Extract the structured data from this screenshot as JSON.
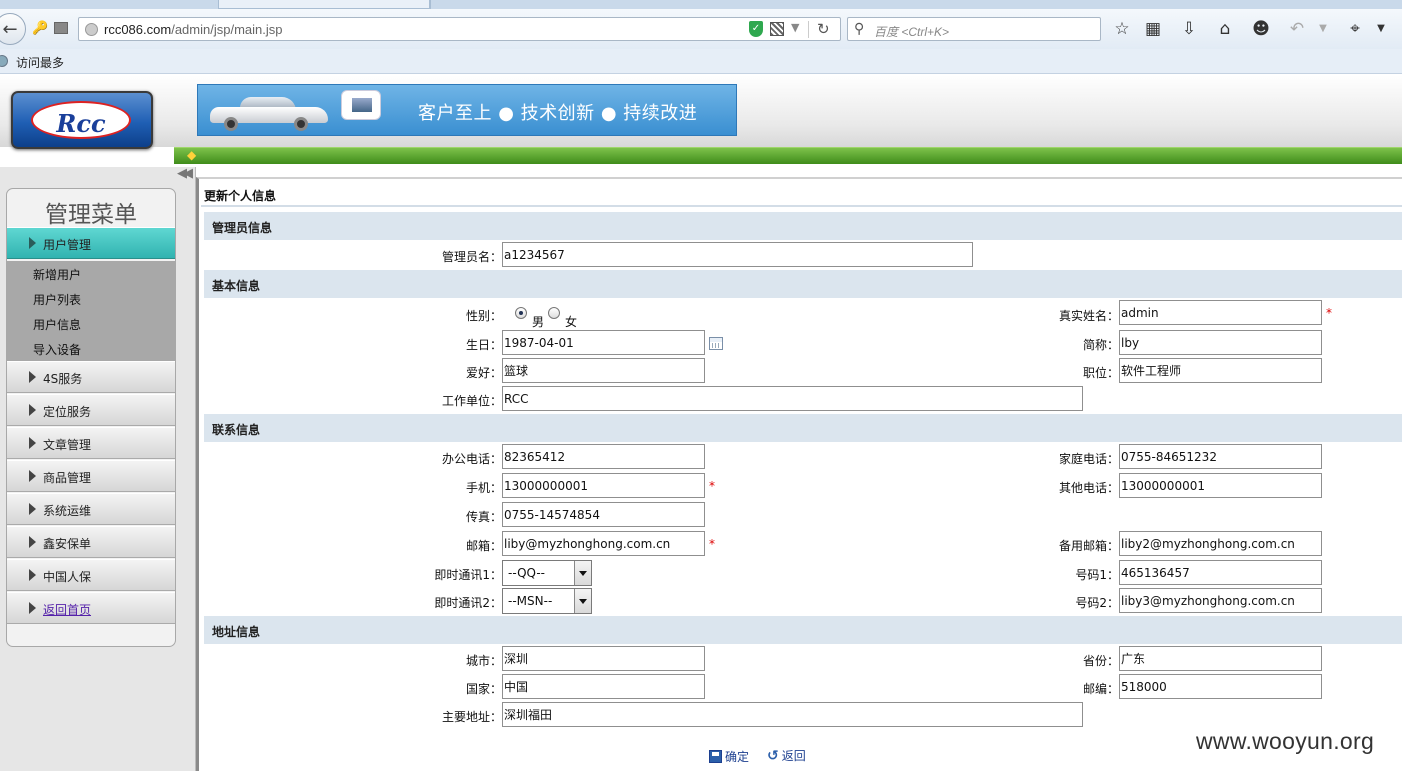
{
  "browser": {
    "url": {
      "host": "rcc086.com",
      "path": "/admin/jsp/main.jsp"
    },
    "search_placeholder": "百度 <Ctrl+K>",
    "bookmarks": [
      {
        "label": "访问最多"
      }
    ]
  },
  "header": {
    "logo_text": "Rcc",
    "slogan": "客户至上 ● 技术创新 ● 持续改进"
  },
  "sidebar": {
    "title": "管理菜单",
    "items": [
      {
        "label": "用户管理",
        "active": true
      },
      {
        "label": "4S服务"
      },
      {
        "label": "定位服务"
      },
      {
        "label": "文章管理"
      },
      {
        "label": "商品管理"
      },
      {
        "label": "系统运维"
      },
      {
        "label": "鑫安保单"
      },
      {
        "label": "中国人保"
      },
      {
        "label": "返回首页",
        "link": true
      }
    ],
    "subitems": [
      "新增用户",
      "用户列表",
      "用户信息",
      "导入设备"
    ]
  },
  "form": {
    "page_title": "更新个人信息",
    "sections": {
      "admin": "管理员信息",
      "basic": "基本信息",
      "contact": "联系信息",
      "address": "地址信息"
    },
    "fields": {
      "admin_name": {
        "label": "管理员名：",
        "value": "a1234567"
      },
      "gender": {
        "label": "性别：",
        "options": [
          "男",
          "女"
        ],
        "selected": "男"
      },
      "real_name": {
        "label": "真实姓名：",
        "value": "admin"
      },
      "birthday": {
        "label": "生日：",
        "value": "1987-04-01"
      },
      "nickname": {
        "label": "简称：",
        "value": "lby"
      },
      "hobby": {
        "label": "爱好：",
        "value": "篮球"
      },
      "position": {
        "label": "职位：",
        "value": "软件工程师"
      },
      "workplace": {
        "label": "工作单位：",
        "value": "RCC"
      },
      "office_phone": {
        "label": "办公电话：",
        "value": "82365412"
      },
      "home_phone": {
        "label": "家庭电话：",
        "value": "0755-84651232"
      },
      "mobile": {
        "label": "手机：",
        "value": "13000000001"
      },
      "other_phone": {
        "label": "其他电话：",
        "value": "13000000001"
      },
      "fax": {
        "label": "传真：",
        "value": "0755-14574854"
      },
      "email": {
        "label": "邮箱：",
        "value": "liby@myzhonghong.com.cn"
      },
      "backup_email": {
        "label": "备用邮箱：",
        "value": "liby2@myzhonghong.com.cn"
      },
      "im1": {
        "label": "即时通讯1：",
        "value": "--QQ--"
      },
      "im1_number": {
        "label": "号码1：",
        "value": "465136457"
      },
      "im2": {
        "label": "即时通讯2：",
        "value": "--MSN--"
      },
      "im2_number": {
        "label": "号码2：",
        "value": "liby3@myzhonghong.com.cn"
      },
      "city": {
        "label": "城市：",
        "value": "深圳"
      },
      "province": {
        "label": "省份：",
        "value": "广东"
      },
      "country": {
        "label": "国家：",
        "value": "中国"
      },
      "postcode": {
        "label": "邮编：",
        "value": "518000"
      },
      "address": {
        "label": "主要地址：",
        "value": "深圳福田"
      }
    },
    "required_mark": "*",
    "buttons": {
      "confirm": "确定",
      "back": "返回"
    }
  },
  "watermark": "www.wooyun.org"
}
